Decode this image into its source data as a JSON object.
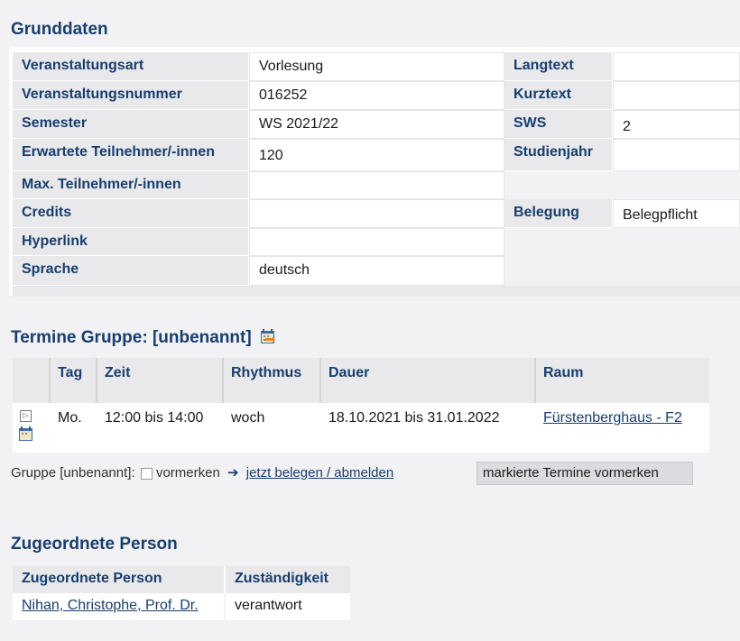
{
  "grunddaten": {
    "title": "Grunddaten",
    "left_rows": [
      {
        "label": "Veranstaltungsart",
        "value": "Vorlesung"
      },
      {
        "label": "Veranstaltungsnummer",
        "value": "016252"
      },
      {
        "label": "Semester",
        "value": "WS 2021/22"
      },
      {
        "label": "Erwartete Teilnehmer/-innen",
        "value": "120"
      },
      {
        "label": "Max. Teilnehmer/-innen",
        "value": ""
      },
      {
        "label": "Credits",
        "value": ""
      },
      {
        "label": "Hyperlink",
        "value": ""
      },
      {
        "label": "Sprache",
        "value": "deutsch"
      }
    ],
    "right_rows": [
      {
        "label": "Langtext",
        "value": ""
      },
      {
        "label": "Kurztext",
        "value": ""
      },
      {
        "label": "SWS",
        "value": "2"
      },
      {
        "label": "Studienjahr",
        "value": ""
      },
      {
        "label": "Belegung",
        "value": "Belegpflicht"
      }
    ]
  },
  "termine": {
    "title": "Termine Gruppe: [unbenannt]",
    "columns": [
      "",
      "Tag",
      "Zeit",
      "Rhythmus",
      "Dauer",
      "Raum"
    ],
    "row": {
      "tag": "Mo.",
      "zeit": "12:00 bis 14:00",
      "rhythmus": "woch",
      "dauer": "18.10.2021 bis 31.01.2022",
      "raum": "Fürstenberghaus - F2"
    },
    "gruppe_label": "Gruppe [unbenannt]:",
    "vormerken_label": "vormerken",
    "belegen_link": "jetzt belegen / abmelden",
    "vormerken_button": "markierte Termine vormerken"
  },
  "personen": {
    "title": "Zugeordnete Person",
    "columns": [
      "Zugeordnete Person",
      "Zuständigkeit"
    ],
    "row": {
      "name": "Nihan, Christophe, Prof. Dr.",
      "role": "verantwort"
    }
  },
  "colors": {
    "heading": "#183e6e",
    "label_bg": "#e9e9ec",
    "page_bg": "#f2f2f4"
  },
  "icons": [
    "calendar-export-icon",
    "expand-icon",
    "arrow-right-icon",
    "checkbox-icon"
  ]
}
